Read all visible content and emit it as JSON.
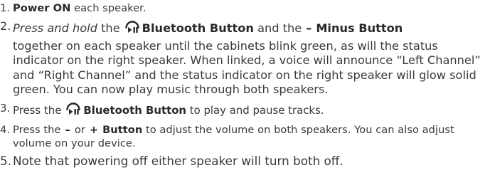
{
  "steps": [
    {
      "number": "1.",
      "parts": {
        "bold": "Power ON",
        "rest": " each speaker."
      }
    },
    {
      "number": "2.",
      "parts": {
        "italic": "Press and hold",
        "the1": " the",
        "bt_label": "Bluetooth Button",
        "and_the": " and the",
        "minus_symbol": "–",
        "minus_label": "Minus Button",
        "rest": "together on each speaker until the cabinets blink green, as will the status indicator on the right speaker. When linked, a voice will announce “Left Channel” and “Right Channel” and the status indicator on the right speaker will glow solid green. You can now play music through both speakers."
      }
    },
    {
      "number": "3.",
      "parts": {
        "pre": "Press the",
        "bt_label": "Bluetooth Button",
        "rest": " to play and pause tracks."
      }
    },
    {
      "number": "4.",
      "parts": {
        "pre": "Press the",
        "minus_symbol": "–",
        "or": "or",
        "plus_symbol": "+",
        "button_label": "Button",
        "rest": " to adjust the volume on both speakers. You can also adjust volume on your device."
      }
    },
    {
      "number": "5.",
      "parts": {
        "text": "Note that powering off either speaker will turn both off."
      }
    }
  ],
  "icons": {
    "bluetooth_play_pause": "bluetooth-play-pause-icon"
  },
  "colors": {
    "text": "#3a3a3a",
    "bold_text": "#2a2a2a"
  }
}
